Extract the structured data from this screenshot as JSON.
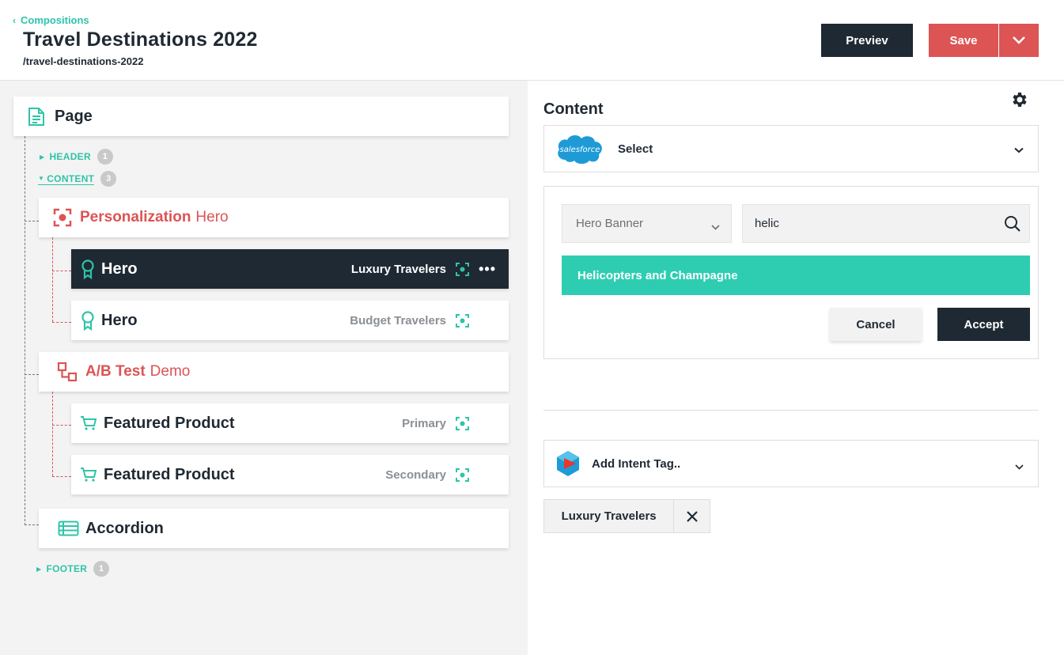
{
  "header": {
    "breadcrumb": "Compositions",
    "title": "Travel Destinations 2022",
    "slug": "/travel-destinations-2022",
    "preview_label": "Previev",
    "save_label": "Save"
  },
  "tree": {
    "page_label": "Page",
    "sections": {
      "header": {
        "label": "HEADER",
        "count": "1"
      },
      "content": {
        "label": "CONTENT",
        "count": "3"
      },
      "footer": {
        "label": "FOOTER",
        "count": "1"
      }
    },
    "personalization": {
      "type": "Personalization",
      "name": "Hero"
    },
    "pers_children": [
      {
        "label": "Hero",
        "variant": "Luxury Travelers",
        "selected": true
      },
      {
        "label": "Hero",
        "variant": "Budget Travelers",
        "selected": false
      }
    ],
    "abtest": {
      "type": "A/B Test",
      "name": "Demo"
    },
    "ab_children": [
      {
        "label": "Featured Product",
        "variant": "Primary"
      },
      {
        "label": "Featured Product",
        "variant": "Secondary"
      }
    ],
    "accordion_label": "Accordion"
  },
  "panel": {
    "title": "Content",
    "source_logo_text": "salesforce",
    "source_select": "Select",
    "type_select": "Hero Banner",
    "search_value": "helic",
    "result": "Helicopters and Champagne",
    "cancel_label": "Cancel",
    "accept_label": "Accept",
    "intent_label": "Add  Intent Tag..",
    "tag_label": "Luxury Travelers"
  },
  "colors": {
    "accent": "#2ec4a9",
    "danger": "#dc5454",
    "dark": "#1f2933"
  },
  "icons": [
    "chevron-left-icon",
    "chevron-down-icon",
    "page-icon",
    "personalization-icon",
    "hero-ribbon-icon",
    "target-icon",
    "more-icon",
    "ab-test-icon",
    "cart-icon",
    "accordion-icon",
    "gear-icon",
    "salesforce-logo",
    "search-icon",
    "intent-logo",
    "close-icon"
  ]
}
